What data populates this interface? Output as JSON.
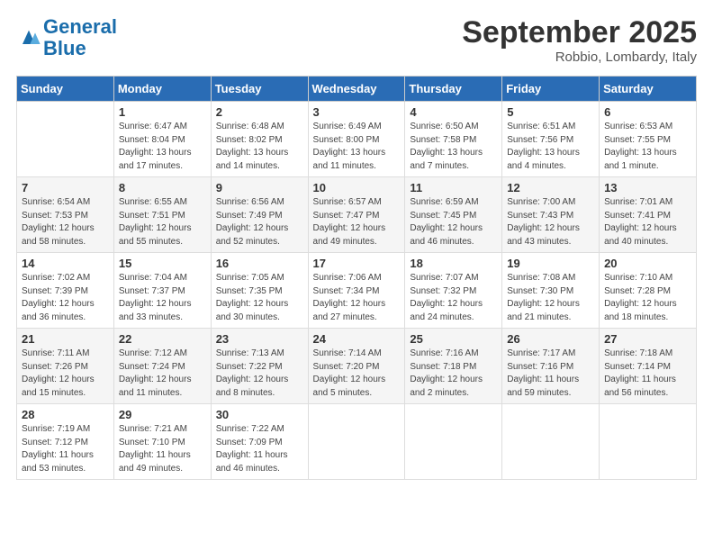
{
  "header": {
    "logo_line1": "General",
    "logo_line2": "Blue",
    "month_title": "September 2025",
    "subtitle": "Robbio, Lombardy, Italy"
  },
  "days_of_week": [
    "Sunday",
    "Monday",
    "Tuesday",
    "Wednesday",
    "Thursday",
    "Friday",
    "Saturday"
  ],
  "weeks": [
    [
      {
        "day": "",
        "content": ""
      },
      {
        "day": "1",
        "content": "Sunrise: 6:47 AM\nSunset: 8:04 PM\nDaylight: 13 hours\nand 17 minutes."
      },
      {
        "day": "2",
        "content": "Sunrise: 6:48 AM\nSunset: 8:02 PM\nDaylight: 13 hours\nand 14 minutes."
      },
      {
        "day": "3",
        "content": "Sunrise: 6:49 AM\nSunset: 8:00 PM\nDaylight: 13 hours\nand 11 minutes."
      },
      {
        "day": "4",
        "content": "Sunrise: 6:50 AM\nSunset: 7:58 PM\nDaylight: 13 hours\nand 7 minutes."
      },
      {
        "day": "5",
        "content": "Sunrise: 6:51 AM\nSunset: 7:56 PM\nDaylight: 13 hours\nand 4 minutes."
      },
      {
        "day": "6",
        "content": "Sunrise: 6:53 AM\nSunset: 7:55 PM\nDaylight: 13 hours\nand 1 minute."
      }
    ],
    [
      {
        "day": "7",
        "content": "Sunrise: 6:54 AM\nSunset: 7:53 PM\nDaylight: 12 hours\nand 58 minutes."
      },
      {
        "day": "8",
        "content": "Sunrise: 6:55 AM\nSunset: 7:51 PM\nDaylight: 12 hours\nand 55 minutes."
      },
      {
        "day": "9",
        "content": "Sunrise: 6:56 AM\nSunset: 7:49 PM\nDaylight: 12 hours\nand 52 minutes."
      },
      {
        "day": "10",
        "content": "Sunrise: 6:57 AM\nSunset: 7:47 PM\nDaylight: 12 hours\nand 49 minutes."
      },
      {
        "day": "11",
        "content": "Sunrise: 6:59 AM\nSunset: 7:45 PM\nDaylight: 12 hours\nand 46 minutes."
      },
      {
        "day": "12",
        "content": "Sunrise: 7:00 AM\nSunset: 7:43 PM\nDaylight: 12 hours\nand 43 minutes."
      },
      {
        "day": "13",
        "content": "Sunrise: 7:01 AM\nSunset: 7:41 PM\nDaylight: 12 hours\nand 40 minutes."
      }
    ],
    [
      {
        "day": "14",
        "content": "Sunrise: 7:02 AM\nSunset: 7:39 PM\nDaylight: 12 hours\nand 36 minutes."
      },
      {
        "day": "15",
        "content": "Sunrise: 7:04 AM\nSunset: 7:37 PM\nDaylight: 12 hours\nand 33 minutes."
      },
      {
        "day": "16",
        "content": "Sunrise: 7:05 AM\nSunset: 7:35 PM\nDaylight: 12 hours\nand 30 minutes."
      },
      {
        "day": "17",
        "content": "Sunrise: 7:06 AM\nSunset: 7:34 PM\nDaylight: 12 hours\nand 27 minutes."
      },
      {
        "day": "18",
        "content": "Sunrise: 7:07 AM\nSunset: 7:32 PM\nDaylight: 12 hours\nand 24 minutes."
      },
      {
        "day": "19",
        "content": "Sunrise: 7:08 AM\nSunset: 7:30 PM\nDaylight: 12 hours\nand 21 minutes."
      },
      {
        "day": "20",
        "content": "Sunrise: 7:10 AM\nSunset: 7:28 PM\nDaylight: 12 hours\nand 18 minutes."
      }
    ],
    [
      {
        "day": "21",
        "content": "Sunrise: 7:11 AM\nSunset: 7:26 PM\nDaylight: 12 hours\nand 15 minutes."
      },
      {
        "day": "22",
        "content": "Sunrise: 7:12 AM\nSunset: 7:24 PM\nDaylight: 12 hours\nand 11 minutes."
      },
      {
        "day": "23",
        "content": "Sunrise: 7:13 AM\nSunset: 7:22 PM\nDaylight: 12 hours\nand 8 minutes."
      },
      {
        "day": "24",
        "content": "Sunrise: 7:14 AM\nSunset: 7:20 PM\nDaylight: 12 hours\nand 5 minutes."
      },
      {
        "day": "25",
        "content": "Sunrise: 7:16 AM\nSunset: 7:18 PM\nDaylight: 12 hours\nand 2 minutes."
      },
      {
        "day": "26",
        "content": "Sunrise: 7:17 AM\nSunset: 7:16 PM\nDaylight: 11 hours\nand 59 minutes."
      },
      {
        "day": "27",
        "content": "Sunrise: 7:18 AM\nSunset: 7:14 PM\nDaylight: 11 hours\nand 56 minutes."
      }
    ],
    [
      {
        "day": "28",
        "content": "Sunrise: 7:19 AM\nSunset: 7:12 PM\nDaylight: 11 hours\nand 53 minutes."
      },
      {
        "day": "29",
        "content": "Sunrise: 7:21 AM\nSunset: 7:10 PM\nDaylight: 11 hours\nand 49 minutes."
      },
      {
        "day": "30",
        "content": "Sunrise: 7:22 AM\nSunset: 7:09 PM\nDaylight: 11 hours\nand 46 minutes."
      },
      {
        "day": "",
        "content": ""
      },
      {
        "day": "",
        "content": ""
      },
      {
        "day": "",
        "content": ""
      },
      {
        "day": "",
        "content": ""
      }
    ]
  ]
}
